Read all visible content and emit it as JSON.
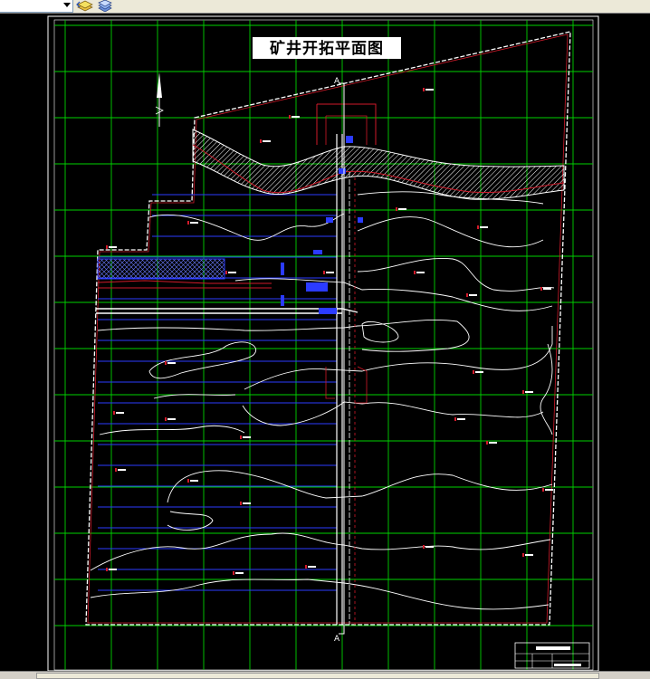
{
  "app": {
    "toolbar": {
      "layer_combo_value": "",
      "icons": [
        "layer-previous-icon",
        "layer-stack-icon"
      ]
    }
  },
  "drawing": {
    "title": "矿井开拓平面图",
    "section_marker_top": "A",
    "section_marker_bottom": "A",
    "colors": {
      "background": "#000000",
      "grid": "#00d200",
      "boundary": "#d11a2a",
      "contour": "#ffffff",
      "workings": "#2b3bff",
      "shaft": "#ffffff",
      "hatch": "#ffffff"
    }
  }
}
